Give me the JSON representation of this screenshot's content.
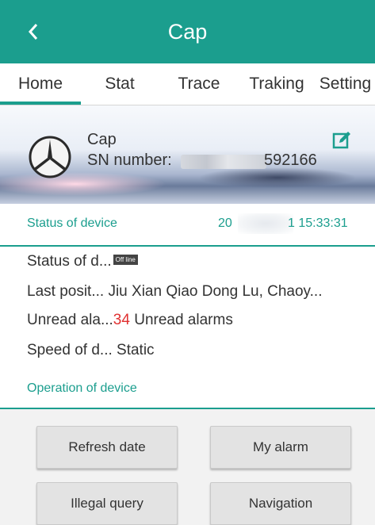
{
  "header": {
    "title": "Cap"
  },
  "tabs": [
    {
      "label": "Home"
    },
    {
      "label": "Stat"
    },
    {
      "label": "Trace"
    },
    {
      "label": "Traking"
    },
    {
      "label": "Setting"
    }
  ],
  "device": {
    "name": "Cap",
    "sn_label": "SN number:",
    "sn_visible_suffix": "592166"
  },
  "status": {
    "title": "Status of device",
    "time_prefix": "20",
    "time_suffix": "1 15:33:31",
    "rows": {
      "device_status_label": "Status of d...",
      "device_status_badge": "Off line",
      "last_position_label": "Last posit...",
      "last_position_value": "Jiu Xian Qiao Dong Lu, Chaoy...",
      "unread_label": "Unread ala...",
      "unread_count": "34",
      "unread_text": " Unread alarms",
      "speed_label": "Speed of d...",
      "speed_value": "Static"
    }
  },
  "operation": {
    "title": "Operation of device",
    "buttons": {
      "refresh": "Refresh date",
      "alarm": "My alarm",
      "illegal": "Illegal query",
      "navigation": "Navigation"
    }
  },
  "icons": {
    "back": "chevron-left",
    "logo": "mercedes-star",
    "edit": "edit-square"
  },
  "colors": {
    "accent": "#1b9e8e",
    "alarm": "#e03030"
  }
}
